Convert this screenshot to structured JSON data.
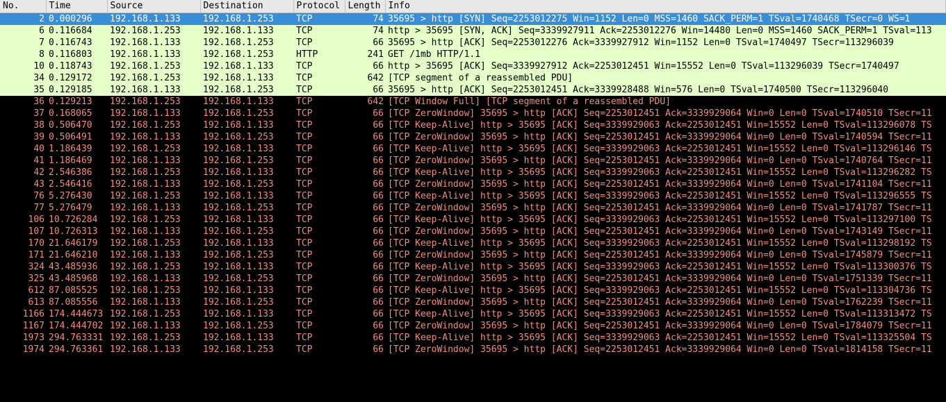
{
  "columns": {
    "no": "No.",
    "time": "Time",
    "source": "Source",
    "destination": "Destination",
    "protocol": "Protocol",
    "length": "Length",
    "info": "Info"
  },
  "rows": [
    {
      "cls": "sel",
      "no": "2",
      "time": "0.000296",
      "src": "192.168.1.133",
      "dst": "192.168.1.253",
      "proto": "TCP",
      "len": "74",
      "info": "35695 > http [SYN] Seq=2253012275 Win=1152 Len=0 MSS=1460 SACK_PERM=1 TSval=1740468 TSecr=0 WS=1"
    },
    {
      "cls": "lgrn",
      "no": "6",
      "time": "0.116684",
      "src": "192.168.1.253",
      "dst": "192.168.1.133",
      "proto": "TCP",
      "len": "74",
      "info": "http > 35695 [SYN, ACK] Seq=3339927911 Ack=2253012276 Win=14480 Len=0 MSS=1460 SACK_PERM=1 TSval=113"
    },
    {
      "cls": "lgrn",
      "no": "7",
      "time": "0.116743",
      "src": "192.168.1.133",
      "dst": "192.168.1.253",
      "proto": "TCP",
      "len": "66",
      "info": "35695 > http [ACK] Seq=2253012276 Ack=3339927912 Win=1152 Len=0 TSval=1740497 TSecr=113296039"
    },
    {
      "cls": "lgrn",
      "no": "8",
      "time": "0.116803",
      "src": "192.168.1.133",
      "dst": "192.168.1.253",
      "proto": "HTTP",
      "len": "241",
      "info": "GET /1mb HTTP/1.1"
    },
    {
      "cls": "lgrn",
      "no": "10",
      "time": "0.118743",
      "src": "192.168.1.253",
      "dst": "192.168.1.133",
      "proto": "TCP",
      "len": "66",
      "info": "http > 35695 [ACK] Seq=3339927912 Ack=2253012451 Win=15552 Len=0 TSval=113296039 TSecr=1740497"
    },
    {
      "cls": "lgrn",
      "no": "34",
      "time": "0.129172",
      "src": "192.168.1.253",
      "dst": "192.168.1.133",
      "proto": "TCP",
      "len": "642",
      "info": "[TCP segment of a reassembled PDU]"
    },
    {
      "cls": "lgrn",
      "no": "35",
      "time": "0.129185",
      "src": "192.168.1.133",
      "dst": "192.168.1.253",
      "proto": "TCP",
      "len": "66",
      "info": "35695 > http [ACK] Seq=2253012451 Ack=3339928488 Win=576 Len=0 TSval=1740500 TSecr=113296040"
    },
    {
      "cls": "dark",
      "no": "36",
      "time": "0.129213",
      "src": "192.168.1.253",
      "dst": "192.168.1.133",
      "proto": "TCP",
      "len": "642",
      "info": "[TCP Window Full] [TCP segment of a reassembled PDU]"
    },
    {
      "cls": "dark",
      "no": "37",
      "time": "0.168065",
      "src": "192.168.1.133",
      "dst": "192.168.1.253",
      "proto": "TCP",
      "len": "66",
      "info": "[TCP ZeroWindow] 35695 > http [ACK] Seq=2253012451 Ack=3339929064 Win=0 Len=0 TSval=1740510 TSecr=11"
    },
    {
      "cls": "dark",
      "no": "38",
      "time": "0.506470",
      "src": "192.168.1.253",
      "dst": "192.168.1.133",
      "proto": "TCP",
      "len": "66",
      "info": "[TCP Keep-Alive] http > 35695 [ACK] Seq=3339929063 Ack=2253012451 Win=15552 Len=0 TSval=113296078 TS"
    },
    {
      "cls": "dark",
      "no": "39",
      "time": "0.506491",
      "src": "192.168.1.133",
      "dst": "192.168.1.253",
      "proto": "TCP",
      "len": "66",
      "info": "[TCP ZeroWindow] 35695 > http [ACK] Seq=2253012451 Ack=3339929064 Win=0 Len=0 TSval=1740594 TSecr=11"
    },
    {
      "cls": "dark",
      "no": "40",
      "time": "1.186439",
      "src": "192.168.1.253",
      "dst": "192.168.1.133",
      "proto": "TCP",
      "len": "66",
      "info": "[TCP Keep-Alive] http > 35695 [ACK] Seq=3339929063 Ack=2253012451 Win=15552 Len=0 TSval=113296146 TS"
    },
    {
      "cls": "dark",
      "no": "41",
      "time": "1.186469",
      "src": "192.168.1.133",
      "dst": "192.168.1.253",
      "proto": "TCP",
      "len": "66",
      "info": "[TCP ZeroWindow] 35695 > http [ACK] Seq=2253012451 Ack=3339929064 Win=0 Len=0 TSval=1740764 TSecr=11"
    },
    {
      "cls": "dark",
      "no": "42",
      "time": "2.546386",
      "src": "192.168.1.253",
      "dst": "192.168.1.133",
      "proto": "TCP",
      "len": "66",
      "info": "[TCP Keep-Alive] http > 35695 [ACK] Seq=3339929063 Ack=2253012451 Win=15552 Len=0 TSval=113296282 TS"
    },
    {
      "cls": "dark",
      "no": "43",
      "time": "2.546416",
      "src": "192.168.1.133",
      "dst": "192.168.1.253",
      "proto": "TCP",
      "len": "66",
      "info": "[TCP ZeroWindow] 35695 > http [ACK] Seq=2253012451 Ack=3339929064 Win=0 Len=0 TSval=1741104 TSecr=11"
    },
    {
      "cls": "dark",
      "no": "76",
      "time": "5.276430",
      "src": "192.168.1.253",
      "dst": "192.168.1.133",
      "proto": "TCP",
      "len": "66",
      "info": "[TCP Keep-Alive] http > 35695 [ACK] Seq=3339929063 Ack=2253012451 Win=15552 Len=0 TSval=113296555 TS"
    },
    {
      "cls": "dark",
      "no": "77",
      "time": "5.276479",
      "src": "192.168.1.133",
      "dst": "192.168.1.253",
      "proto": "TCP",
      "len": "66",
      "info": "[TCP ZeroWindow] 35695 > http [ACK] Seq=2253012451 Ack=3339929064 Win=0 Len=0 TSval=1741787 TSecr=11"
    },
    {
      "cls": "dark",
      "no": "106",
      "time": "10.726284",
      "src": "192.168.1.253",
      "dst": "192.168.1.133",
      "proto": "TCP",
      "len": "66",
      "info": "[TCP Keep-Alive] http > 35695 [ACK] Seq=3339929063 Ack=2253012451 Win=15552 Len=0 TSval=113297100 TS"
    },
    {
      "cls": "dark",
      "no": "107",
      "time": "10.726313",
      "src": "192.168.1.133",
      "dst": "192.168.1.253",
      "proto": "TCP",
      "len": "66",
      "info": "[TCP ZeroWindow] 35695 > http [ACK] Seq=2253012451 Ack=3339929064 Win=0 Len=0 TSval=1743149 TSecr=11"
    },
    {
      "cls": "dark",
      "no": "170",
      "time": "21.646179",
      "src": "192.168.1.253",
      "dst": "192.168.1.133",
      "proto": "TCP",
      "len": "66",
      "info": "[TCP Keep-Alive] http > 35695 [ACK] Seq=3339929063 Ack=2253012451 Win=15552 Len=0 TSval=113298192 TS"
    },
    {
      "cls": "dark",
      "no": "171",
      "time": "21.646210",
      "src": "192.168.1.133",
      "dst": "192.168.1.253",
      "proto": "TCP",
      "len": "66",
      "info": "[TCP ZeroWindow] 35695 > http [ACK] Seq=2253012451 Ack=3339929064 Win=0 Len=0 TSval=1745879 TSecr=11"
    },
    {
      "cls": "dark",
      "no": "324",
      "time": "43.485936",
      "src": "192.168.1.253",
      "dst": "192.168.1.133",
      "proto": "TCP",
      "len": "66",
      "info": "[TCP Keep-Alive] http > 35695 [ACK] Seq=3339929063 Ack=2253012451 Win=15552 Len=0 TSval=113300376 TS"
    },
    {
      "cls": "dark",
      "no": "325",
      "time": "43.485968",
      "src": "192.168.1.133",
      "dst": "192.168.1.253",
      "proto": "TCP",
      "len": "66",
      "info": "[TCP ZeroWindow] 35695 > http [ACK] Seq=2253012451 Ack=3339929064 Win=0 Len=0 TSval=1751339 TSecr=11"
    },
    {
      "cls": "dark",
      "no": "612",
      "time": "87.085525",
      "src": "192.168.1.253",
      "dst": "192.168.1.133",
      "proto": "TCP",
      "len": "66",
      "info": "[TCP Keep-Alive] http > 35695 [ACK] Seq=3339929063 Ack=2253012451 Win=15552 Len=0 TSval=113304736 TS"
    },
    {
      "cls": "dark",
      "no": "613",
      "time": "87.085556",
      "src": "192.168.1.133",
      "dst": "192.168.1.253",
      "proto": "TCP",
      "len": "66",
      "info": "[TCP ZeroWindow] 35695 > http [ACK] Seq=2253012451 Ack=3339929064 Win=0 Len=0 TSval=1762239 TSecr=11"
    },
    {
      "cls": "dark",
      "no": "1166",
      "time": "174.444673",
      "src": "192.168.1.253",
      "dst": "192.168.1.133",
      "proto": "TCP",
      "len": "66",
      "info": "[TCP Keep-Alive] http > 35695 [ACK] Seq=3339929063 Ack=2253012451 Win=15552 Len=0 TSval=113313472 TS"
    },
    {
      "cls": "dark",
      "no": "1167",
      "time": "174.444702",
      "src": "192.168.1.133",
      "dst": "192.168.1.253",
      "proto": "TCP",
      "len": "66",
      "info": "[TCP ZeroWindow] 35695 > http [ACK] Seq=2253012451 Ack=3339929064 Win=0 Len=0 TSval=1784079 TSecr=11"
    },
    {
      "cls": "dark",
      "no": "1973",
      "time": "294.763331",
      "src": "192.168.1.253",
      "dst": "192.168.1.133",
      "proto": "TCP",
      "len": "66",
      "info": "[TCP Keep-Alive] http > 35695 [ACK] Seq=3339929063 Ack=2253012451 Win=15552 Len=0 TSval=113325504 TS"
    },
    {
      "cls": "dark",
      "no": "1974",
      "time": "294.763361",
      "src": "192.168.1.133",
      "dst": "192.168.1.253",
      "proto": "TCP",
      "len": "66",
      "info": "[TCP ZeroWindow] 35695 > http [ACK] Seq=2253012451 Ack=3339929064 Win=0 Len=0 TSval=1814158 TSecr=11"
    }
  ]
}
